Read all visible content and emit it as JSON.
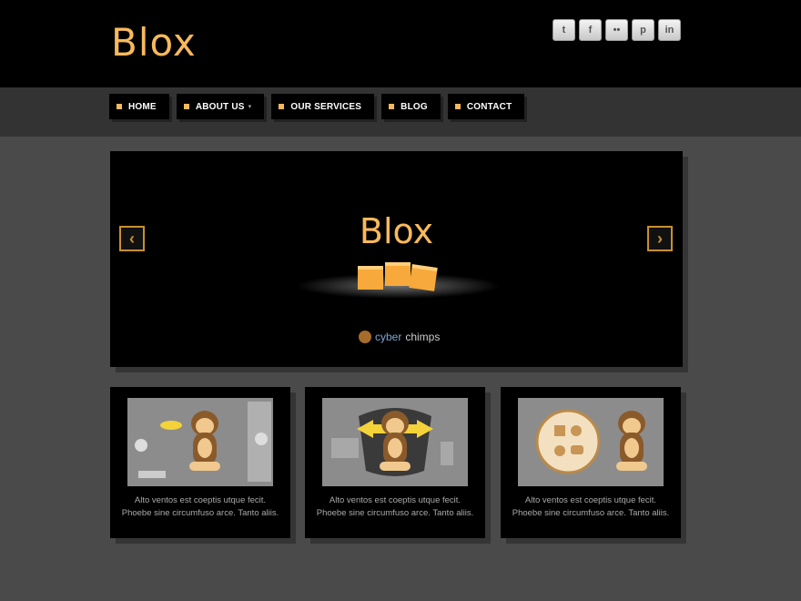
{
  "header": {
    "logo": "Blox",
    "social": [
      {
        "icon": "twitter-icon",
        "glyph": "t"
      },
      {
        "icon": "facebook-icon",
        "glyph": "f"
      },
      {
        "icon": "flickr-icon",
        "glyph": "••"
      },
      {
        "icon": "pinterest-icon",
        "glyph": "p"
      },
      {
        "icon": "linkedin-icon",
        "glyph": "in"
      }
    ]
  },
  "nav": {
    "items": [
      {
        "label": "HOME"
      },
      {
        "label": "ABOUT US",
        "caret": "▾"
      },
      {
        "label": "OUR SERVICES"
      },
      {
        "label": "BLOG"
      },
      {
        "label": "CONTACT"
      }
    ]
  },
  "slider": {
    "title": "Blox",
    "brand_a": "cyber",
    "brand_b": "chimps",
    "prev_glyph": "‹",
    "next_glyph": "›"
  },
  "features": [
    {
      "text": "Alto ventos est coeptis utque fecit. Phoebe sine circumfuso arce. Tanto aliis."
    },
    {
      "text": "Alto ventos est coeptis utque fecit. Phoebe sine circumfuso arce. Tanto aliis."
    },
    {
      "text": "Alto ventos est coeptis utque fecit. Phoebe sine circumfuso arce. Tanto aliis."
    }
  ],
  "colors": {
    "accent": "#f8b95c",
    "header_bg": "#000000",
    "nav_bar_bg": "#333333",
    "page_bg": "#4a4a4a"
  }
}
